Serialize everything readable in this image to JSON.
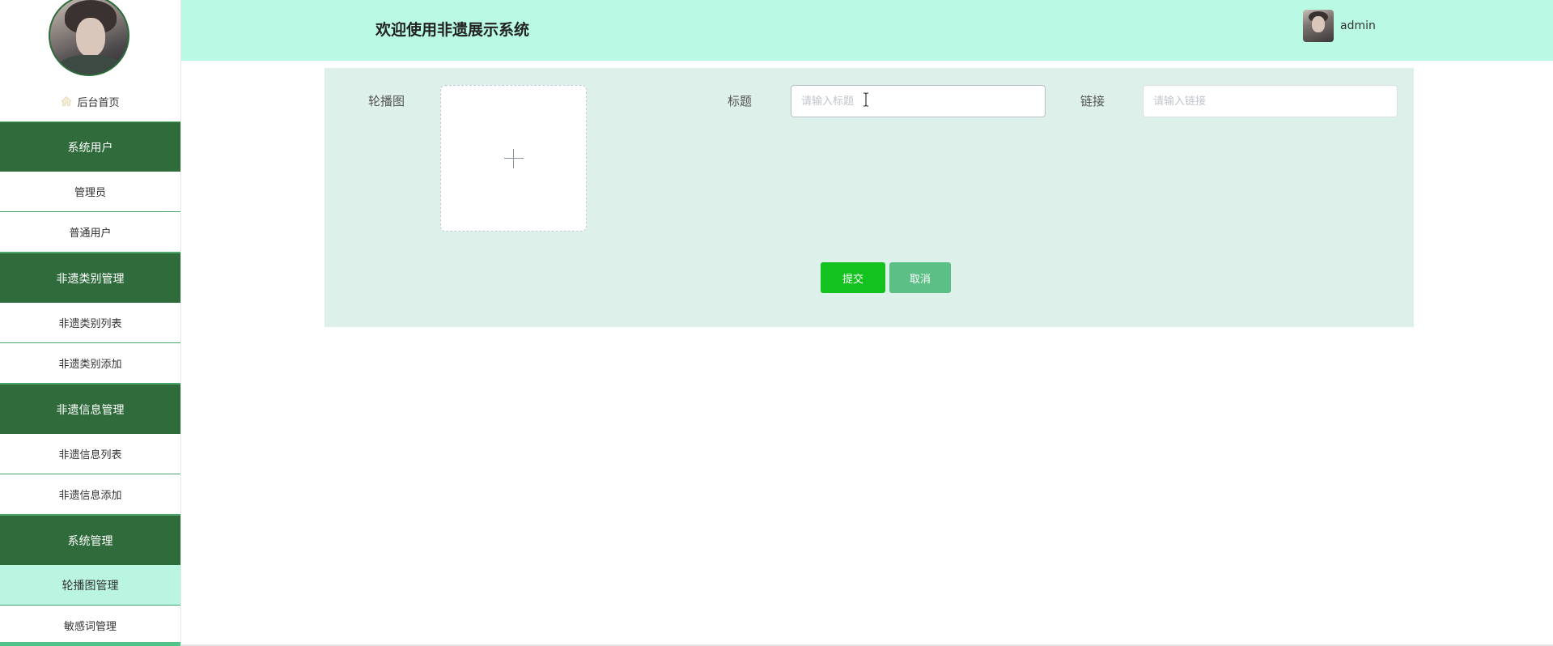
{
  "sidebar": {
    "home_label": "后台首页",
    "groups": [
      {
        "label": "系统用户",
        "items": [
          "管理员",
          "普通用户"
        ]
      },
      {
        "label": "非遗类别管理",
        "items": [
          "非遗类别列表",
          "非遗类别添加"
        ]
      },
      {
        "label": "非遗信息管理",
        "items": [
          "非遗信息列表",
          "非遗信息添加"
        ]
      },
      {
        "label": "系统管理",
        "items": [
          "轮播图管理",
          "敏感词管理"
        ]
      }
    ],
    "active_item": "轮播图管理"
  },
  "header": {
    "title": "欢迎使用非遗展示系统",
    "username": "admin"
  },
  "form": {
    "carousel_label": "轮播图",
    "title_label": "标题",
    "title_placeholder": "请输入标题",
    "title_value": "",
    "link_label": "链接",
    "link_placeholder": "请输入链接",
    "link_value": "",
    "submit_label": "提交",
    "cancel_label": "取消"
  },
  "colors": {
    "header_bg": "#baf9e4",
    "nav_group_bg": "#2f6b3b",
    "active_item_bg": "#baf5e2",
    "panel_bg": "#ddf0ea",
    "submit_bg": "#13c21f",
    "cancel_bg": "#5cbf86"
  }
}
